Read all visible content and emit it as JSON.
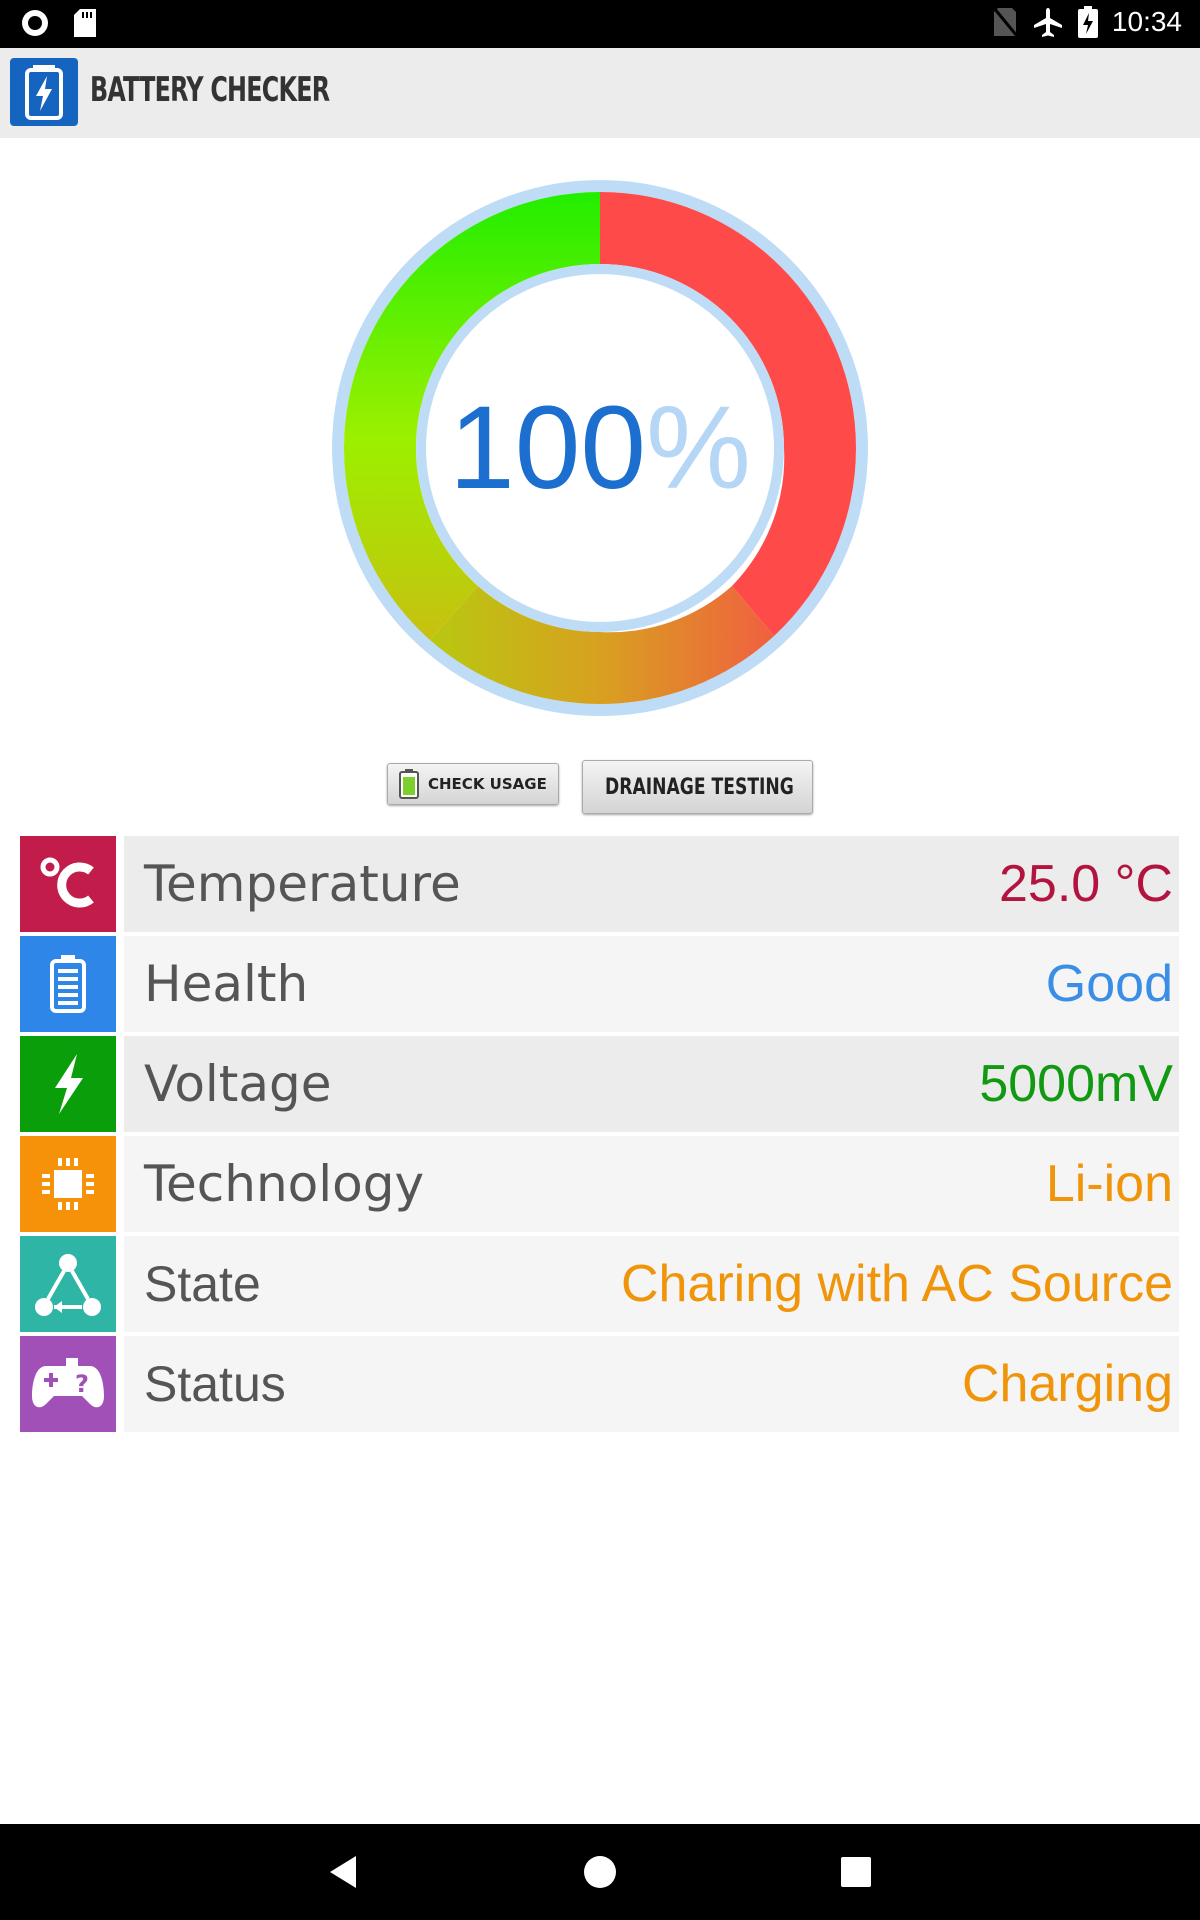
{
  "status_bar": {
    "time": "10:34"
  },
  "app_bar": {
    "title": "BATTERY CHECKER"
  },
  "gauge": {
    "value": "100",
    "unit": "%",
    "level": 1.0
  },
  "buttons": {
    "check_usage": "CHECK USAGE",
    "drainage_testing": "DRAINAGE TESTING"
  },
  "rows": [
    {
      "label": "Temperature",
      "value": "25.0 °C",
      "icon_text": "°C",
      "icon_color": "#c21c4a",
      "value_color": "#b3143f",
      "cell_bg": "#ececec"
    },
    {
      "label": "Health",
      "value": "Good",
      "icon_color": "#2e86e8",
      "value_color": "#3b8ee6",
      "cell_bg": "#f5f5f5"
    },
    {
      "label": "Voltage",
      "value": "5000mV",
      "icon_color": "#0a9e0a",
      "value_color": "#119a11",
      "cell_bg": "#ececec"
    },
    {
      "label": "Technology",
      "value": "Li-ion",
      "icon_color": "#f5920a",
      "value_color": "#f0950a",
      "cell_bg": "#f5f5f5"
    },
    {
      "label": "State",
      "value": "Charing with AC Source",
      "icon_color": "#2fb5a5",
      "value_color": "#f0950a",
      "cell_bg": "#f5f5f5"
    },
    {
      "label": "Status",
      "value": "Charging",
      "icon_color": "#a150b8",
      "value_color": "#f0950a",
      "cell_bg": "#f5f5f5"
    }
  ],
  "icons": {
    "status_left": [
      "record-icon",
      "sd-card-icon"
    ],
    "status_right": [
      "no-sim-icon",
      "airplane-icon",
      "battery-charging-icon"
    ],
    "rows": [
      "celsius-icon",
      "battery-icon",
      "lightning-icon",
      "chip-icon",
      "share-network-icon",
      "gamepad-question-icon"
    ],
    "nav": [
      "back-icon",
      "home-icon",
      "recents-icon"
    ]
  }
}
